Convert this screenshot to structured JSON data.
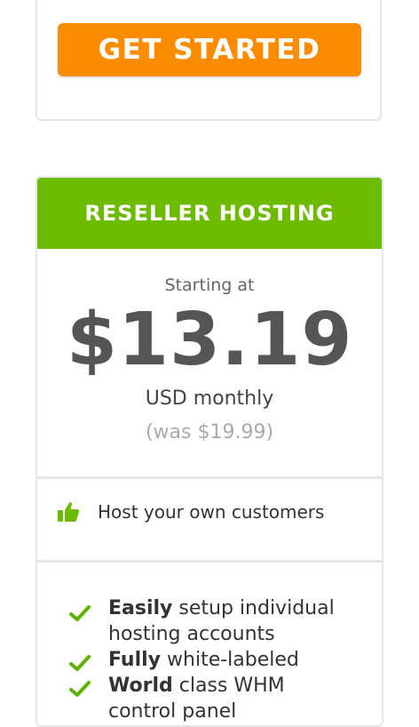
{
  "top_card": {
    "button_label": "GET STARTED"
  },
  "reseller": {
    "title": "RESELLER HOSTING",
    "starting_at": "Starting at",
    "price": "$13.19",
    "period": "USD monthly",
    "was_price": "(was $19.99)",
    "highlight": "Host your own customers",
    "features": [
      {
        "bold": "Easily",
        "text": " setup individual hosting accounts"
      },
      {
        "bold": "Fully",
        "text": " white-labeled"
      },
      {
        "bold": "World",
        "text": " class WHM control panel"
      }
    ]
  },
  "colors": {
    "cta_orange": "#fb8c00",
    "header_green": "#6dbb00",
    "check_green": "#5bb300"
  },
  "icons": {
    "highlight_icon": "thumbs-up-icon",
    "feature_icon": "check-icon"
  }
}
